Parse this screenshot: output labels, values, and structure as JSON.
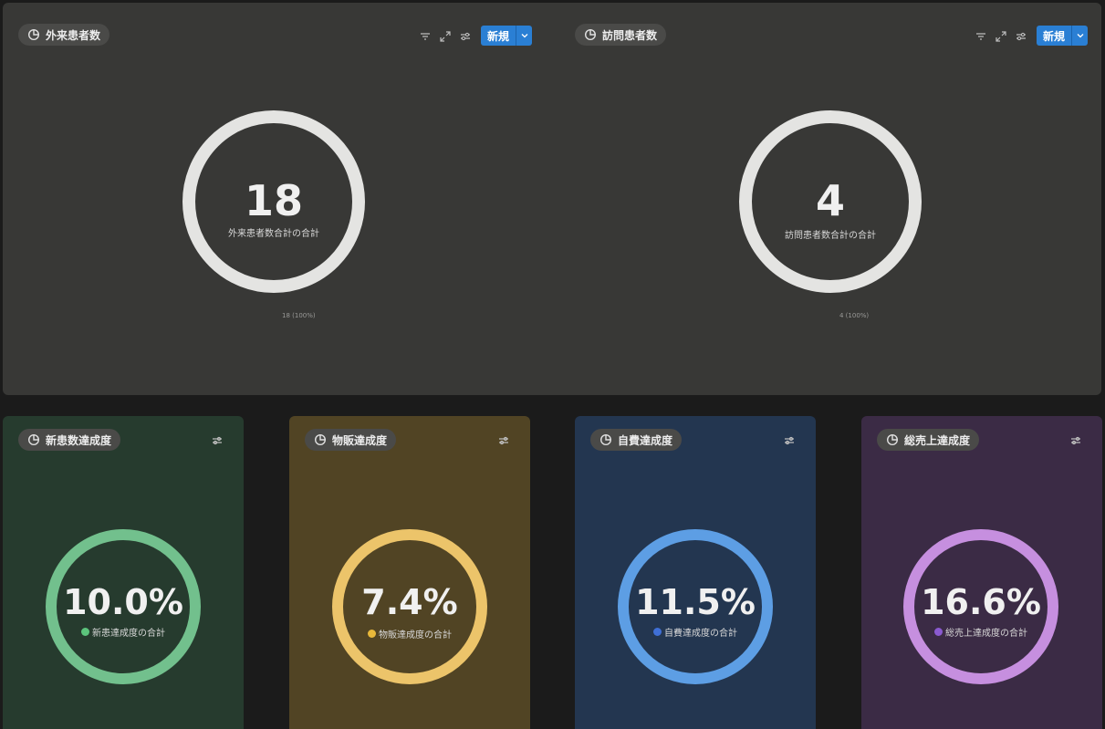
{
  "top": {
    "outpatient": {
      "title": "外来患者数",
      "value": "18",
      "label": "外来患者数合計の合計",
      "footnote": "18 (100%)",
      "new_label": "新規"
    },
    "visit": {
      "title": "訪問患者数",
      "value": "4",
      "label": "訪問患者数合計の合計",
      "footnote": "4 (100%)",
      "new_label": "新規"
    }
  },
  "cards": [
    {
      "title": "新患数達成度",
      "value": "10.0%",
      "label": "新患達成度の合計",
      "bg": "#263b2e",
      "ring": "#72c08d",
      "dot": "#5cc47c"
    },
    {
      "title": "物販達成度",
      "value": "7.4%",
      "label": "物販達成度の合計",
      "bg": "#514424",
      "ring": "#ecc46a",
      "dot": "#e8b83a"
    },
    {
      "title": "自費達成度",
      "value": "11.5%",
      "label": "自費達成度の合計",
      "bg": "#233650",
      "ring": "#5d9ee4",
      "dot": "#3f6fd6"
    },
    {
      "title": "総売上達成度",
      "value": "16.6%",
      "label": "総売上達成度の合計",
      "bg": "#3b2b45",
      "ring": "#c68fdf",
      "dot": "#8a5ad0"
    }
  ],
  "icons": {
    "chip": "pie-chart-icon",
    "filter": "filter-icon",
    "expand": "expand-icon",
    "settings": "sliders-icon",
    "dropdown": "chevron-down-icon"
  },
  "colors": {
    "top_ring": "#e4e4e2",
    "primary_button": "#2a7fd4"
  }
}
